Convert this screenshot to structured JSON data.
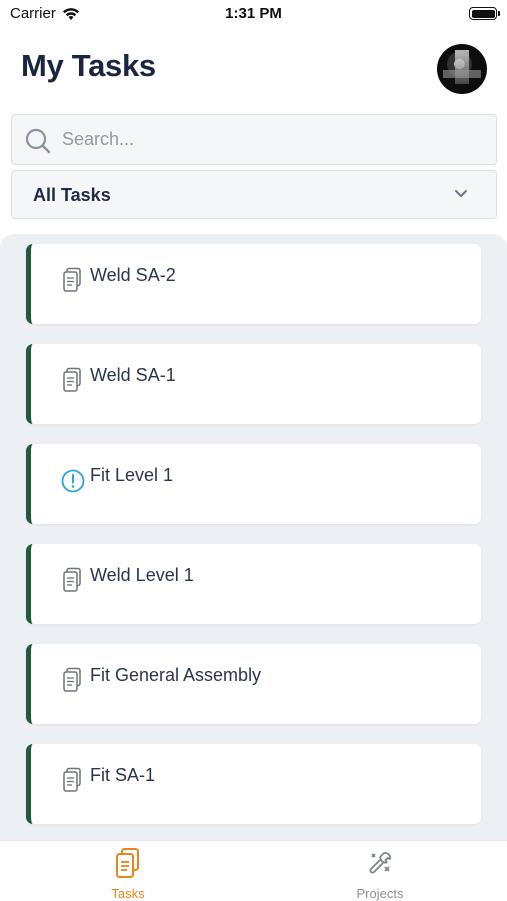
{
  "status_bar": {
    "carrier": "Carrier",
    "time": "1:31 PM"
  },
  "header": {
    "title": "My Tasks"
  },
  "search": {
    "placeholder": "Search..."
  },
  "filter": {
    "selected": "All Tasks"
  },
  "tasks": [
    {
      "label": "Weld SA-2",
      "icon": "document-icon"
    },
    {
      "label": "Weld SA-1",
      "icon": "document-icon"
    },
    {
      "label": "Fit Level 1",
      "icon": "alert-circle-icon"
    },
    {
      "label": "Weld Level 1",
      "icon": "document-icon"
    },
    {
      "label": "Fit General Assembly",
      "icon": "document-icon"
    },
    {
      "label": "Fit SA-1",
      "icon": "document-icon"
    }
  ],
  "tab_bar": {
    "tasks_label": "Tasks",
    "projects_label": "Projects",
    "active_color": "#e8851c",
    "inactive_color": "#8a9099"
  },
  "colors": {
    "card_accent": "#1f5a3a",
    "alert": "#2aa4dc",
    "list_background": "#eceff4"
  }
}
